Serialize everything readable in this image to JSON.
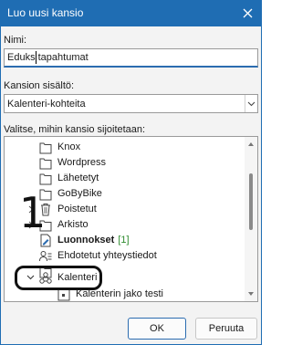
{
  "window": {
    "title": "Luo uusi kansio"
  },
  "name_field": {
    "label": "Nimi:",
    "value": "Eduks tapahtumat"
  },
  "contents_field": {
    "label": "Kansion sisältö:",
    "value": "Kalenteri-kohteita"
  },
  "tree_field": {
    "label": "Valitse, mihin kansio sijoitetaan:",
    "items": [
      {
        "label": "Knox"
      },
      {
        "label": "Wordpress"
      },
      {
        "label": "Lähetetyt"
      },
      {
        "label": "GoByBike"
      },
      {
        "label": "Poistetut"
      },
      {
        "label": "Arkisto"
      },
      {
        "label": "Luonnokset",
        "count": "[1]"
      },
      {
        "label": "Ehdotetut yhteystiedot"
      },
      {
        "label": "Kalenteri"
      },
      {
        "label": "Kalenterin jako testi"
      }
    ]
  },
  "annotation": {
    "number": "1"
  },
  "buttons": {
    "ok": "OK",
    "cancel": "Peruuta"
  },
  "colors": {
    "titlebar": "#1f6db3",
    "count": "#2e8b2e"
  }
}
